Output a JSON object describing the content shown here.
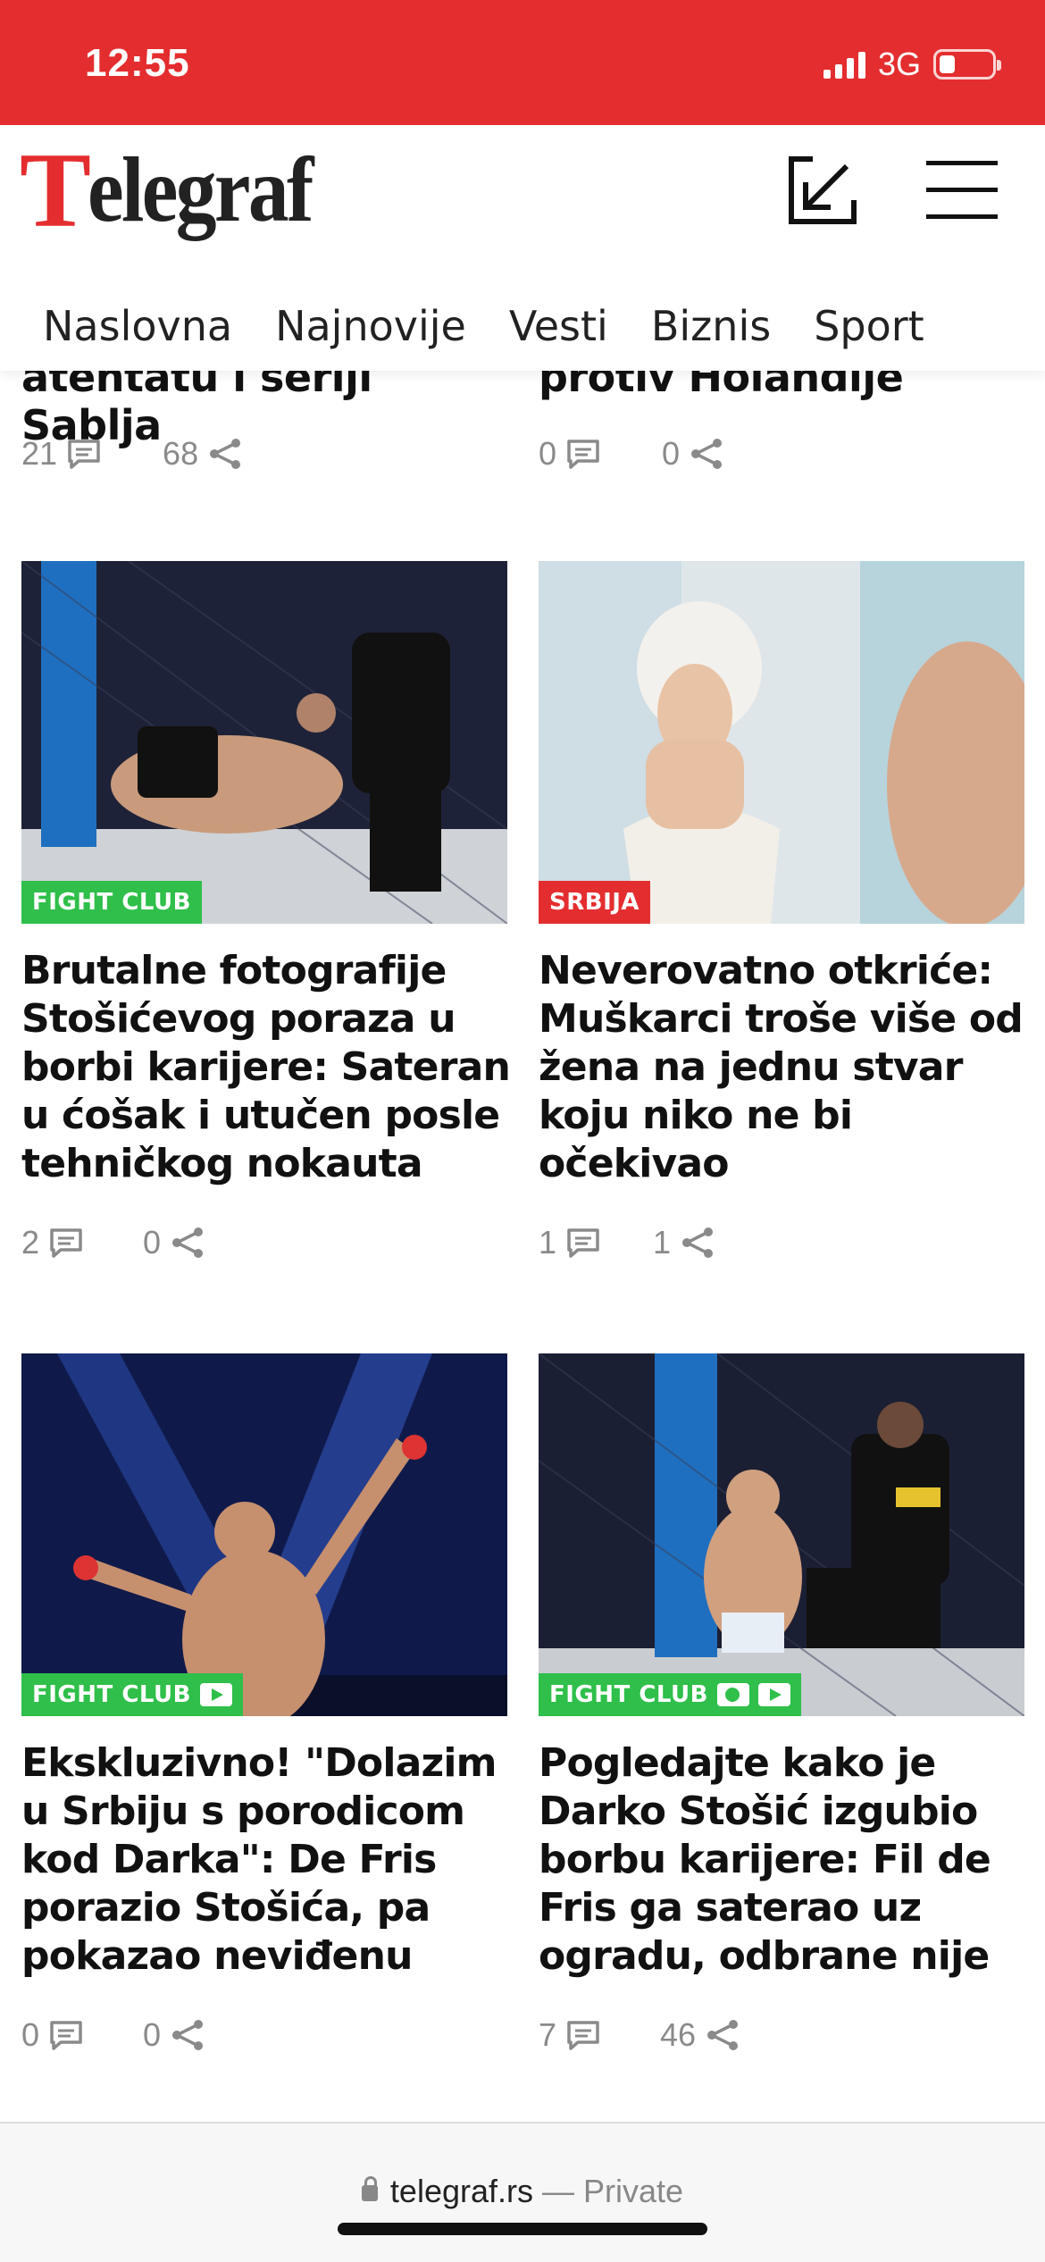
{
  "status_bar": {
    "time": "12:55",
    "network": "3G"
  },
  "header": {
    "logo_first": "T",
    "logo_rest": "elegraf",
    "nav": [
      "Naslovna",
      "Najnovije",
      "Vesti",
      "Biznis",
      "Sport"
    ]
  },
  "top_cut": [
    {
      "title": "atentatu i seriji Sablja",
      "comments": "21",
      "shares": "68"
    },
    {
      "title": "protiv Holandije",
      "comments": "0",
      "shares": "0"
    }
  ],
  "articles": [
    {
      "tag": "FIGHT CLUB",
      "tag_color": "#2fbf4a",
      "media": "",
      "title": "Brutalne fotografije Stošićevog poraza u borbi karijere: Sateran u ćošak i utučen posle tehničkog nokauta",
      "comments": "2",
      "shares": "0"
    },
    {
      "tag": "SRBIJA",
      "tag_color": "#e42d2f",
      "media": "",
      "title": "Neverovatno otkriće: Muškarci troše više od žena na jednu stvar koju niko ne bi očekivao",
      "comments": "1",
      "shares": "1"
    },
    {
      "tag": "FIGHT CLUB",
      "tag_color": "#2fbf4a",
      "media": "video",
      "title": "Ekskluzivno! \"Dolazim u Srbiju s porodicom kod Darka\": De Fris porazio Stošića, pa pokazao neviđenu",
      "comments": "0",
      "shares": "0"
    },
    {
      "tag": "FIGHT CLUB",
      "tag_color": "#2fbf4a",
      "media": "gallery-video",
      "title": "Pogledajte kako je Darko Stošić izgubio borbu karijere: Fil de Fris ga saterao uz ogradu, odbrane nije",
      "comments": "7",
      "shares": "46"
    }
  ],
  "browser": {
    "domain": "telegraf.rs",
    "separator": " — ",
    "mode": "Private"
  }
}
